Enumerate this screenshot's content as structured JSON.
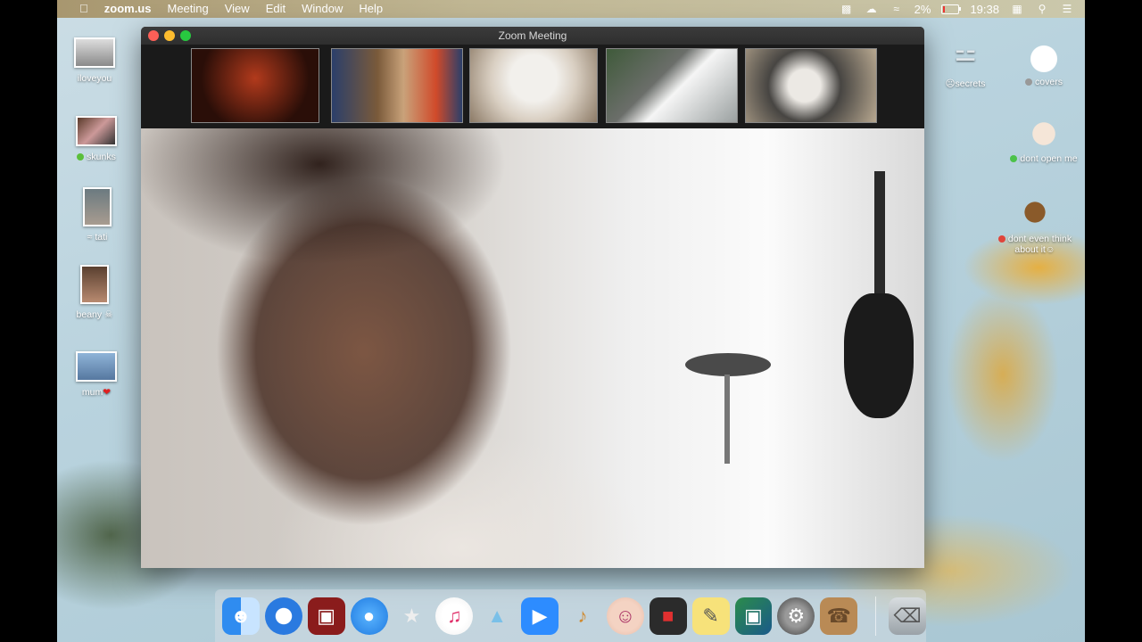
{
  "menubar": {
    "apple": "",
    "app_name": "zoom.us",
    "menus": [
      "Meeting",
      "View",
      "Edit",
      "Window",
      "Help"
    ],
    "battery": "2%",
    "time": "19:38"
  },
  "desktop": {
    "icons_left": [
      {
        "label": "iloveyou"
      },
      {
        "label": "skunks"
      },
      {
        "label": "tati"
      },
      {
        "label": "beany"
      },
      {
        "label": "mum"
      }
    ],
    "icons_right": [
      {
        "label": "secrets"
      },
      {
        "label": "covers"
      },
      {
        "label": "dont open me"
      },
      {
        "label": "dont even think about it"
      }
    ]
  },
  "zoom_window": {
    "title": "Zoom Meeting",
    "participants": 5
  },
  "dock": {
    "apps": [
      "Finder",
      "Safari",
      "Photo Booth",
      "Messages",
      "Sketch",
      "iTunes",
      "Sequel Pro",
      "Zoom",
      "GarageBand",
      "Face",
      "Photo Booth Red",
      "Stickies",
      "Preview",
      "System Preferences",
      "Contacts"
    ],
    "trash": "Trash"
  }
}
